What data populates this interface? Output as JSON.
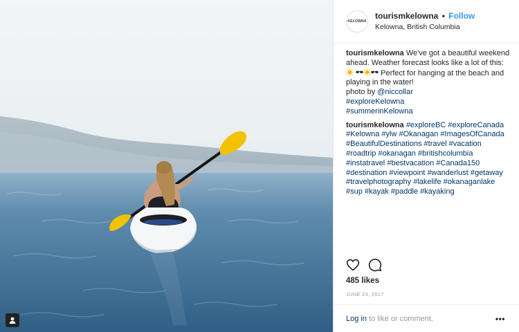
{
  "account": {
    "username": "tourismkelowna",
    "separator": "•",
    "follow_label": "Follow",
    "location": "Kelowna, British Columbia",
    "avatar_text": "KELOWNA"
  },
  "caption": {
    "username": "tourismkelowna",
    "text_1": "We've got a beautiful weekend ahead. Weather forecast looks like a lot of this:",
    "emoji_1": "sun",
    "emoji_2": "sunglasses",
    "text_2": "Perfect for hanging at the beach and playing in the water!",
    "photo_by_label": "photo by",
    "photographer": "@niccollar",
    "hashtags": [
      "#exploreKelowna",
      "#summerinKelowna"
    ]
  },
  "hashtag_comment": {
    "username": "tourismkelowna",
    "tags": [
      "#exploreBC",
      "#exploreCanada",
      "#Kelowna",
      "#ylw",
      "#Okanagan",
      "#ImagesOfCanada",
      "#BeautifulDestinations",
      "#travel",
      "#vacation",
      "#roadtrip",
      "#okanagan",
      "#britishcolumbia",
      "#instatravel",
      "#bestvacation",
      "#Canada150",
      "#destination",
      "#viewpoint",
      "#wanderlust",
      "#getaway",
      "#travelphotography",
      "#lakelife",
      "#okanaganlake",
      "#sup",
      "#kayak",
      "#paddle",
      "#kayaking"
    ]
  },
  "actions": {
    "like_icon": "heart-icon",
    "comment_icon": "comment-icon"
  },
  "likes": "485 likes",
  "date": "JUNE 23, 2017",
  "footer": {
    "login_label": "Log in",
    "rest": " to like or comment.",
    "more_label": "•••"
  },
  "colors": {
    "link": "#003569",
    "follow": "#3897f0",
    "paddle": "#f2c200",
    "water": "#3f6f93"
  }
}
